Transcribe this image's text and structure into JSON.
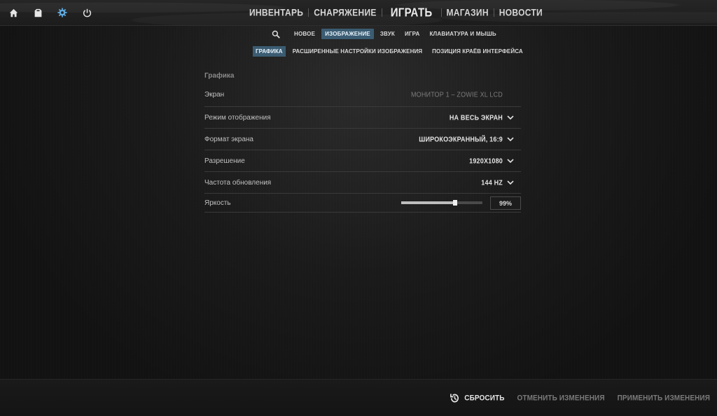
{
  "top_icons": [
    "home-icon",
    "inventory-icon",
    "settings-icon",
    "power-icon"
  ],
  "main_nav": {
    "inventory": "ИНВЕНТАРЬ",
    "loadout": "СНАРЯЖЕНИЕ",
    "play": "ИГРАТЬ",
    "store": "МАГАЗИН",
    "news": "НОВОСТИ"
  },
  "sub_nav": {
    "tabs": [
      "НОВОЕ",
      "ИЗОБРАЖЕНИЕ",
      "ЗВУК",
      "ИГРА",
      "КЛАВИАТУРА И МЫШЬ"
    ],
    "active": "ИЗОБРАЖЕНИЕ"
  },
  "sub_sub_nav": {
    "tabs": [
      "ГРАФИКА",
      "РАСШИРЕННЫЕ НАСТРОЙКИ ИЗОБРАЖЕНИЯ",
      "ПОЗИЦИЯ КРАЁВ ИНТЕРФЕЙСА"
    ],
    "active": "ГРАФИКА"
  },
  "settings": {
    "section_title": "Графика",
    "screen": {
      "label": "Экран",
      "value": "МОНИТОР 1 – ZOWIE XL LCD"
    },
    "display_mode": {
      "label": "Режим отображения",
      "value": "НА ВЕСЬ ЭКРАН"
    },
    "aspect_ratio": {
      "label": "Формат экрана",
      "value": "ШИРОКОЭКРАННЫЙ, 16:9"
    },
    "resolution": {
      "label": "Разрешение",
      "value": "1920X1080"
    },
    "refresh_rate": {
      "label": "Частота обновления",
      "value": "144 HZ"
    },
    "brightness": {
      "label": "Яркость",
      "value_text": "99%",
      "level_percent": 66
    }
  },
  "footer": {
    "reset": "СБРОСИТЬ",
    "discard": "ОТМЕНИТЬ ИЗМЕНЕНИЯ",
    "apply": "ПРИМЕНИТЬ ИЗМЕНЕНИЯ"
  },
  "colors": {
    "accent_active_tab": "#3b5c72",
    "settings_icon": "#5fa9dd"
  }
}
